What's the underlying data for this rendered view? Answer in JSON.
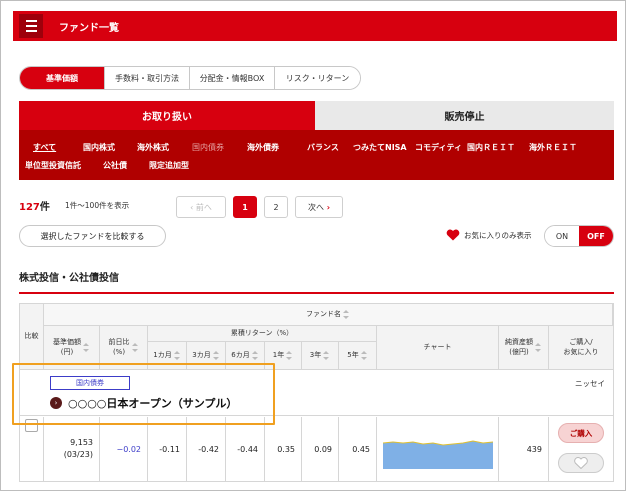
{
  "header": {
    "title": "ファンド一覧"
  },
  "tabs": [
    {
      "label": "基準価額",
      "active": true
    },
    {
      "label": "手数料・取引方法",
      "active": false
    },
    {
      "label": "分配金・情報BOX",
      "active": false
    },
    {
      "label": "リスク・リターン",
      "active": false
    }
  ],
  "handling": {
    "on_label": "お取り扱い",
    "off_label": "販売停止"
  },
  "categories": [
    "すべて",
    "国内株式",
    "海外株式",
    "国内債券",
    "海外債券",
    "バランス",
    "つみたてNISA",
    "コモディティ",
    "国内ＲＥＩＴ",
    "海外ＲＥＩＴ",
    "単位型投資信託",
    "公社債",
    "限定追加型"
  ],
  "result": {
    "count": "127",
    "count_unit": "件",
    "range": "1件〜100件を表示"
  },
  "pagination": {
    "prev": "前へ",
    "pages": [
      "1",
      "2"
    ],
    "next": "次へ"
  },
  "compare_button": "選択したファンドを比較する",
  "favorites_filter": {
    "label": "お気に入りのみ表示",
    "on": "ON",
    "off": "OFF"
  },
  "section_title": "株式投信・公社債投信",
  "table": {
    "headers": {
      "compare": "比較",
      "fund_name": "ファンド名",
      "nav": "基準価額\n(円)",
      "prev_day": "前日比\n(%)",
      "cumulative_return": "累積リターン（%）",
      "periods": [
        "1カ月",
        "3カ月",
        "6カ月",
        "1年",
        "3年",
        "5年"
      ],
      "chart": "チャート",
      "net_assets": "純資産額\n(億円)",
      "purchase": "ご購入/\nお気に入り"
    },
    "fund": {
      "category": "国内債券",
      "name": "○○○○日本オープン（サンプル）",
      "company": "ニッセイ",
      "nav": "9,153",
      "nav_date": "(03/23)",
      "prev_day": "−0.02",
      "returns": [
        "-0.11",
        "-0.42",
        "-0.44",
        "0.35",
        "0.09",
        "0.45"
      ],
      "net_assets": "439",
      "buy_label": "ご購入"
    }
  }
}
